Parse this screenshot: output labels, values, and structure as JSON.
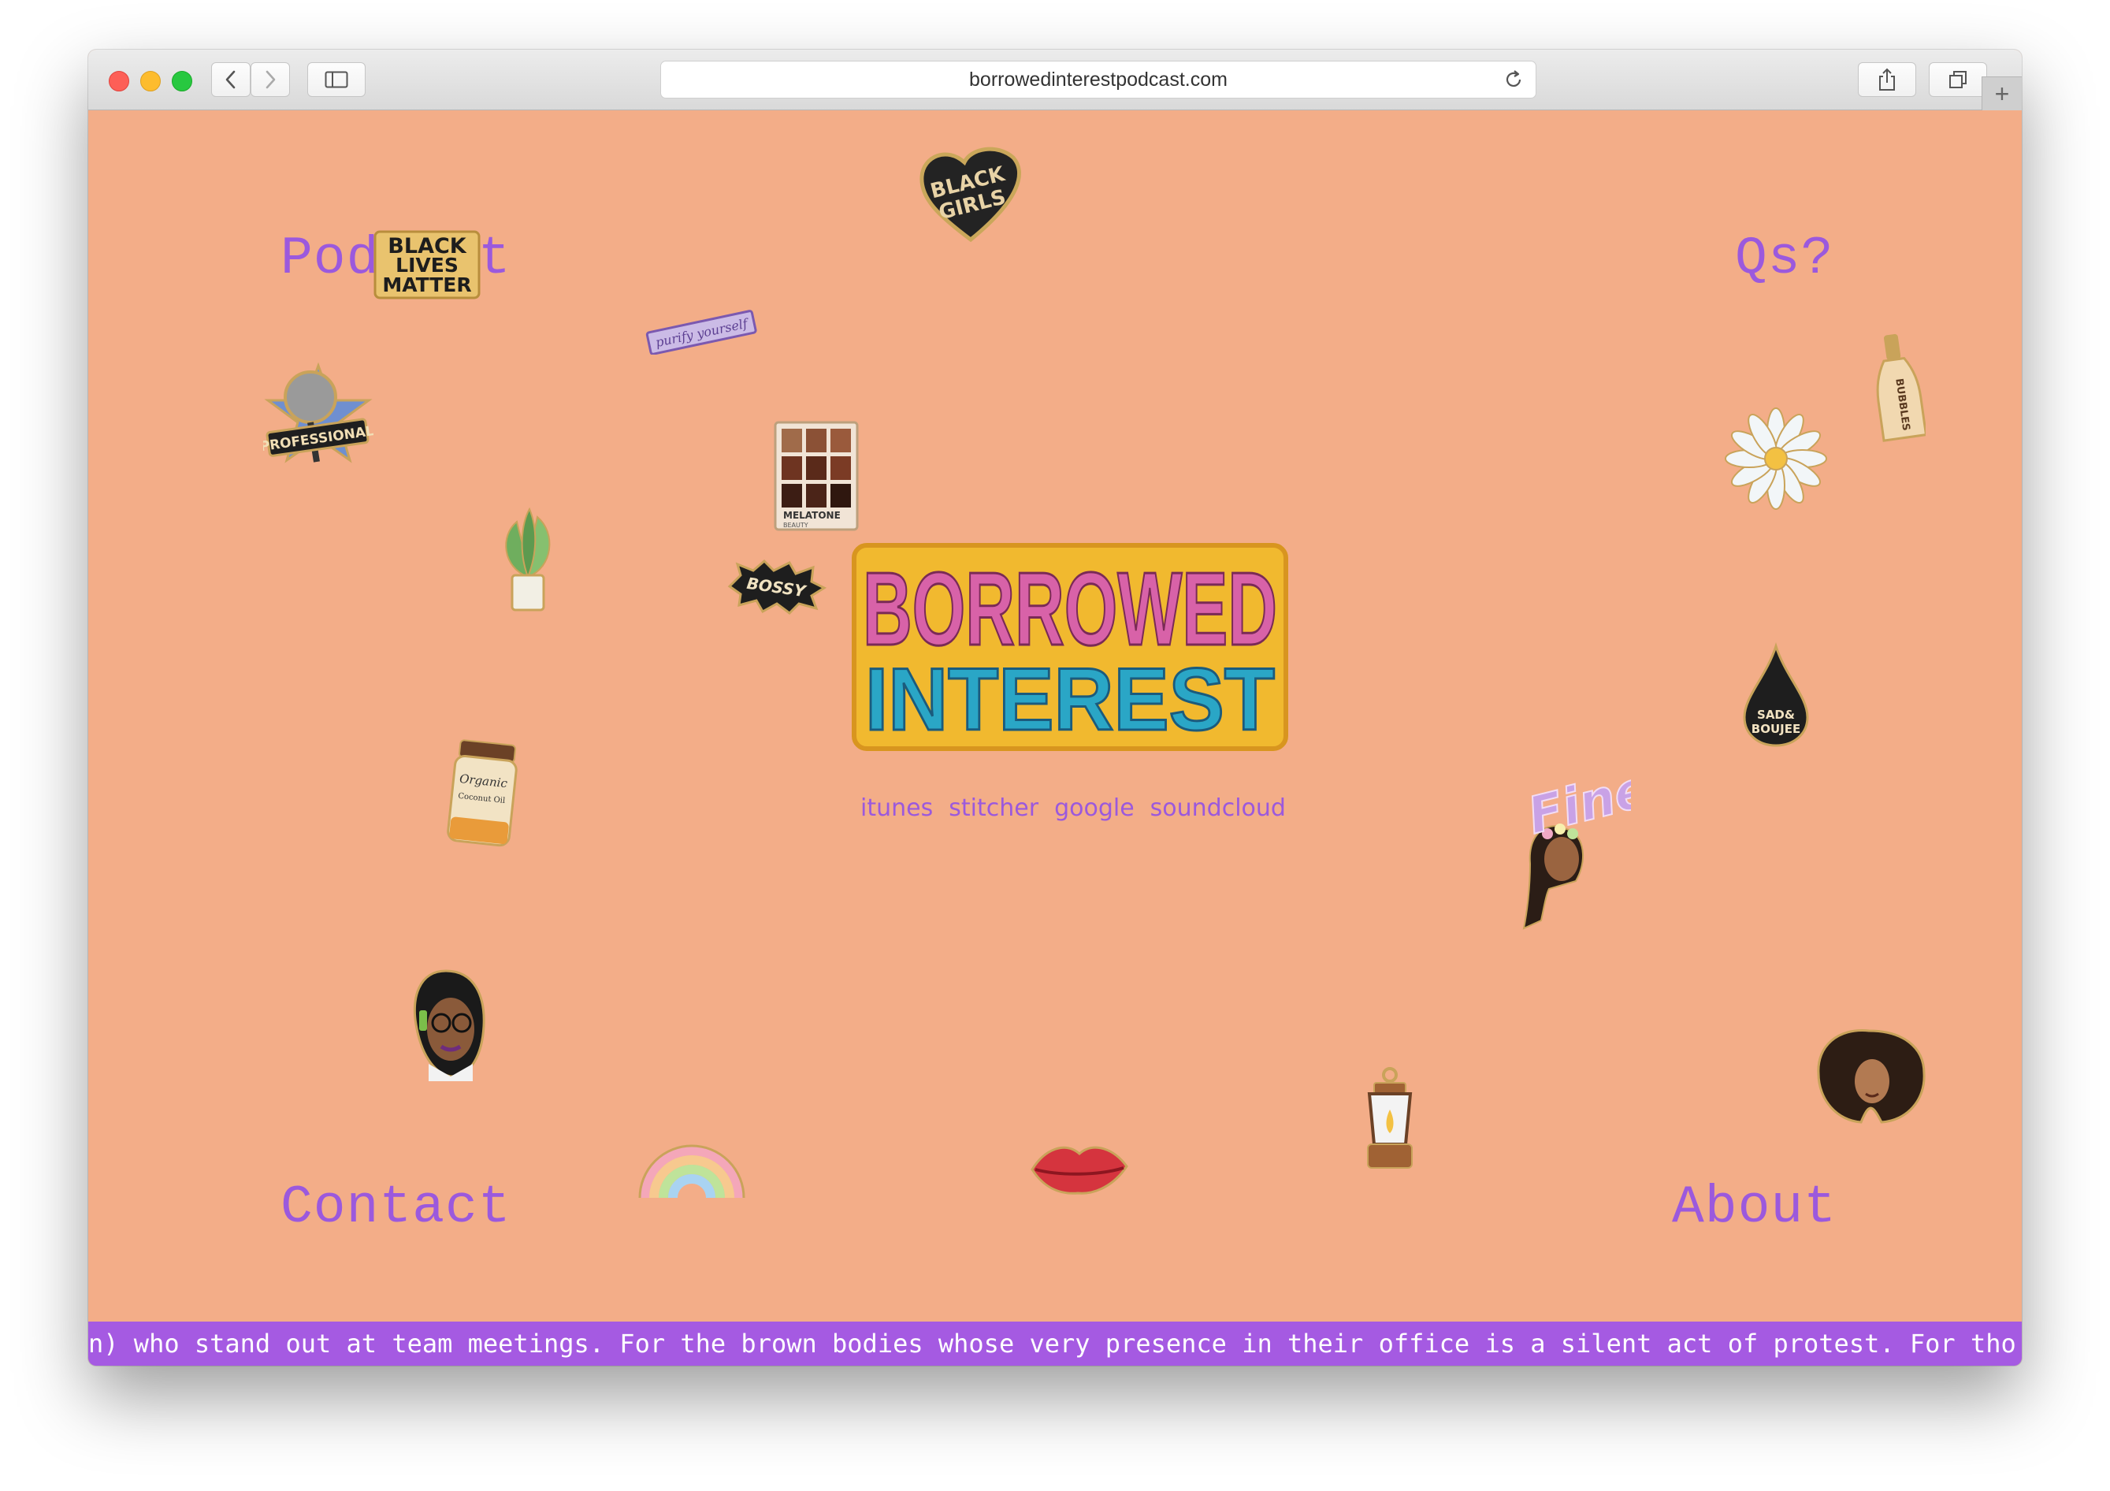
{
  "browser": {
    "url": "borrowedinterestpodcast.com"
  },
  "nav": {
    "podcast": "Podcast",
    "qs": "Qs?",
    "contact": "Contact",
    "about": "About"
  },
  "logo": {
    "line1": "BORROWED",
    "line2": "INTEREST"
  },
  "platforms": [
    "itunes",
    "stitcher",
    "google",
    "soundcloud"
  ],
  "ticker": {
    "text": "n) who stand out at team meetings. For the brown bodies whose very presence in their office is a silent act of protest. For tho"
  },
  "pins": {
    "black_girls": {
      "line1": "BLACK",
      "line2": "GIRLS"
    },
    "blm": {
      "line1": "BLACK",
      "line2": "LIVES",
      "line3": "MATTER"
    },
    "purify": "purify yourself",
    "professional": "PROFESSIONAL",
    "bossy": "BOSSY",
    "palette": {
      "line1": "MELATONE",
      "line2": "BEAUTY"
    },
    "jar": {
      "line1": "Organic",
      "line2": "Coconut Oil"
    },
    "fine": "Fine",
    "sad_boujee": {
      "line1": "SAD&",
      "line2": "BOUJEE"
    },
    "bottle": "BUBBLES"
  },
  "colors": {
    "page_bg": "#f3ad88",
    "accent_purple": "#9b59dd",
    "ticker_bg": "#a55ae2"
  }
}
